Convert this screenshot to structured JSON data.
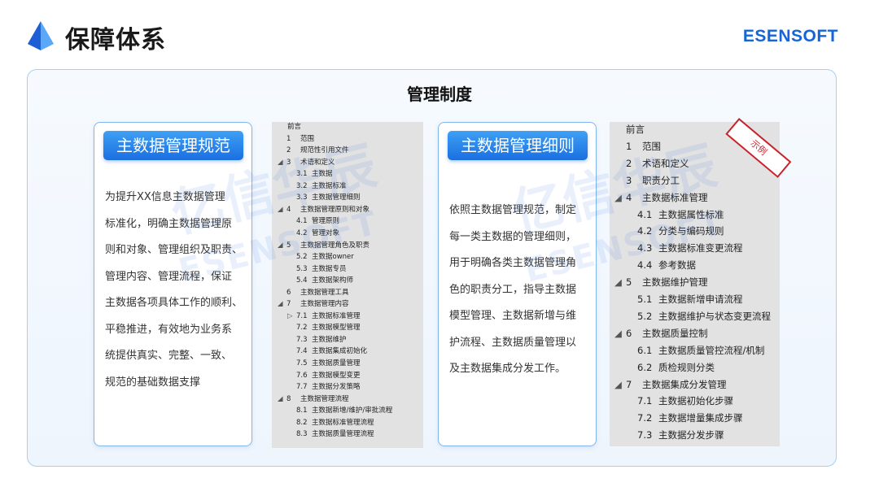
{
  "header": {
    "title": "保障体系",
    "brand": "ESENSOFT",
    "logo_icon": "blue-prism-logo-icon"
  },
  "panel": {
    "title": "管理制度"
  },
  "cards": [
    {
      "title": "主数据管理规范",
      "body_lines": [
        "为提升XX信息主数据管理",
        "标准化，明确主数据管理原",
        "则和对象、管理组织及职责、",
        "管理内容、管理流程，保证",
        "主数据各项具体工作的顺利、",
        "平稳推进，有效地为业务系",
        "统提供真实、完整、一致、",
        "规范的基础数据支撑"
      ]
    },
    {
      "title": "主数据管理细则",
      "body_lines": [
        "依照主数据管理规范，制定",
        "每一类主数据的管理细则，",
        "用于明确各类主数据管理角",
        "色的职责分工，指导主数据",
        "模型管理、主数据新增与维",
        "护流程、主数据质量管理以",
        "及主数据集成分发工作。"
      ]
    }
  ],
  "toc_left": [
    {
      "level": 0,
      "marker": "",
      "num": "",
      "text": "前言"
    },
    {
      "level": 1,
      "marker": "",
      "num": "1",
      "text": "范围"
    },
    {
      "level": 1,
      "marker": "",
      "num": "2",
      "text": "规范性引用文件"
    },
    {
      "level": 1,
      "marker": "◢",
      "num": "3",
      "text": "术语和定义"
    },
    {
      "level": 2,
      "marker": "",
      "num": "3.1",
      "text": "主数据"
    },
    {
      "level": 2,
      "marker": "",
      "num": "3.2",
      "text": "主数据标准"
    },
    {
      "level": 2,
      "marker": "",
      "num": "3.3",
      "text": "主数据管理细则"
    },
    {
      "level": 1,
      "marker": "◢",
      "num": "4",
      "text": "主数据管理原则和对象"
    },
    {
      "level": 2,
      "marker": "",
      "num": "4.1",
      "text": "管理原则"
    },
    {
      "level": 2,
      "marker": "",
      "num": "4.2",
      "text": "管理对象"
    },
    {
      "level": 1,
      "marker": "◢",
      "num": "5",
      "text": "主数据管理角色及职责"
    },
    {
      "level": 2,
      "marker": "",
      "num": "5.2",
      "text": "主数据owner"
    },
    {
      "level": 2,
      "marker": "",
      "num": "5.3",
      "text": "主数据专员"
    },
    {
      "level": 2,
      "marker": "",
      "num": "5.4",
      "text": "主数据架构师"
    },
    {
      "level": 1,
      "marker": "",
      "num": "6",
      "text": "主数据管理工具"
    },
    {
      "level": 1,
      "marker": "◢",
      "num": "7",
      "text": "主数据管理内容"
    },
    {
      "level": 2,
      "marker": "▷",
      "num": "7.1",
      "text": "主数据标准管理"
    },
    {
      "level": 2,
      "marker": "",
      "num": "7.2",
      "text": "主数据模型管理"
    },
    {
      "level": 2,
      "marker": "",
      "num": "7.3",
      "text": "主数据维护"
    },
    {
      "level": 2,
      "marker": "",
      "num": "7.4",
      "text": "主数据集成初始化"
    },
    {
      "level": 2,
      "marker": "",
      "num": "7.5",
      "text": "主数据质量管理"
    },
    {
      "level": 2,
      "marker": "",
      "num": "7.6",
      "text": "主数据模型变更"
    },
    {
      "level": 2,
      "marker": "",
      "num": "7.7",
      "text": "主数据分发策略"
    },
    {
      "level": 1,
      "marker": "◢",
      "num": "8",
      "text": "主数据管理流程"
    },
    {
      "level": 2,
      "marker": "",
      "num": "8.1",
      "text": "主数据新增/维护/审批流程"
    },
    {
      "level": 2,
      "marker": "",
      "num": "8.2",
      "text": "主数据标准管理流程"
    },
    {
      "level": 2,
      "marker": "",
      "num": "8.3",
      "text": "主数据质量管理流程"
    }
  ],
  "toc_right": [
    {
      "level": 0,
      "marker": "",
      "num": "",
      "text": "前言"
    },
    {
      "level": 1,
      "marker": "",
      "num": "1",
      "text": "范围"
    },
    {
      "level": 1,
      "marker": "",
      "num": "2",
      "text": "术语和定义"
    },
    {
      "level": 1,
      "marker": "",
      "num": "3",
      "text": "职责分工"
    },
    {
      "level": 1,
      "marker": "◢",
      "num": "4",
      "text": "主数据标准管理"
    },
    {
      "level": 2,
      "marker": "",
      "num": "4.1",
      "text": "主数据属性标准"
    },
    {
      "level": 2,
      "marker": "",
      "num": "4.2",
      "text": "分类与编码规则"
    },
    {
      "level": 2,
      "marker": "",
      "num": "4.3",
      "text": "主数据标准变更流程"
    },
    {
      "level": 2,
      "marker": "",
      "num": "4.4",
      "text": "参考数据"
    },
    {
      "level": 1,
      "marker": "◢",
      "num": "5",
      "text": "主数据维护管理"
    },
    {
      "level": 2,
      "marker": "",
      "num": "5.1",
      "text": "主数据新增申请流程"
    },
    {
      "level": 2,
      "marker": "",
      "num": "5.2",
      "text": "主数据维护与状态变更流程"
    },
    {
      "level": 1,
      "marker": "◢",
      "num": "6",
      "text": "主数据质量控制"
    },
    {
      "level": 2,
      "marker": "",
      "num": "6.1",
      "text": "主数据质量管控流程/机制"
    },
    {
      "level": 2,
      "marker": "",
      "num": "6.2",
      "text": "质检规则分类"
    },
    {
      "level": 1,
      "marker": "◢",
      "num": "7",
      "text": "主数据集成分发管理"
    },
    {
      "level": 2,
      "marker": "",
      "num": "7.1",
      "text": "主数据初始化步骤"
    },
    {
      "level": 2,
      "marker": "",
      "num": "7.2",
      "text": "主数据增量集成步骤"
    },
    {
      "level": 2,
      "marker": "",
      "num": "7.3",
      "text": "主数据分发步骤"
    }
  ],
  "watermark": {
    "cn": "亿信华辰",
    "en": "ESENSOFT"
  },
  "ribbon": "示例",
  "colors": {
    "brand_blue": "#1565d8",
    "card_head_blue": "#1a6fe0",
    "ribbon_red": "#c8232c"
  }
}
